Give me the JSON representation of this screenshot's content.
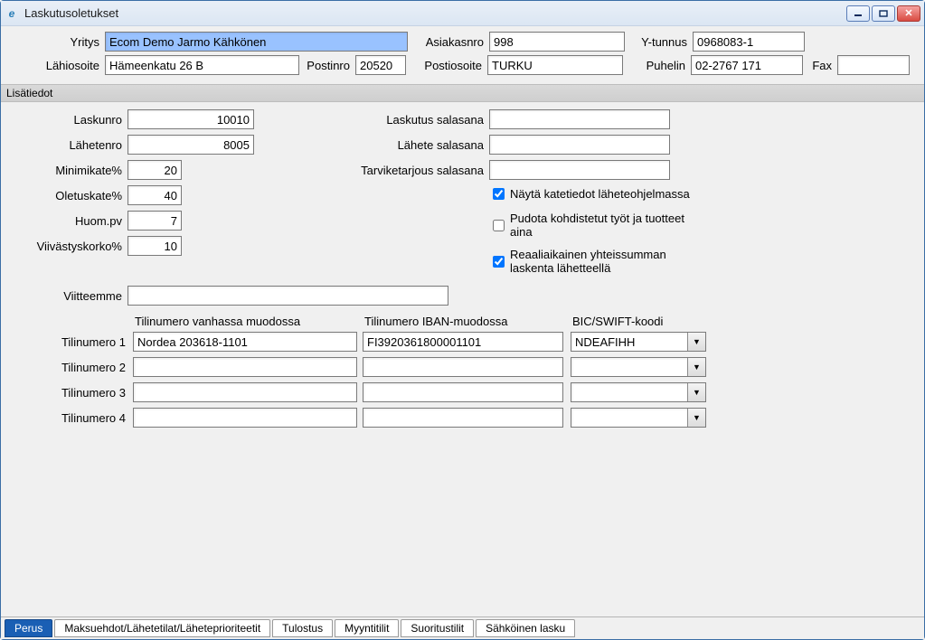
{
  "window": {
    "title": "Laskutusoletukset"
  },
  "top": {
    "labels": {
      "yritys": "Yritys",
      "asiakasnro": "Asiakasnro",
      "ytunnus": "Y-tunnus",
      "lahiosoite": "Lähiosoite",
      "postinro": "Postinro",
      "postiosoite": "Postiosoite",
      "puhelin": "Puhelin",
      "fax": "Fax"
    },
    "values": {
      "yritys": "Ecom Demo Jarmo Kähkönen",
      "asiakasnro": "998",
      "ytunnus": "0968083-1",
      "lahiosoite": "Hämeenkatu 26 B",
      "postinro": "20520",
      "postiosoite": "TURKU",
      "puhelin": "02-2767 171",
      "fax": ""
    }
  },
  "section": {
    "lisatiedot": "Lisätiedot"
  },
  "left": {
    "labels": {
      "laskunro": "Laskunro",
      "lahetenro": "Lähetenro",
      "minimikate": "Minimikate%",
      "oletuskate": "Oletuskate%",
      "huompv": "Huom.pv",
      "viivastyskorko": "Viivästyskorko%",
      "viitteemme": "Viitteemme"
    },
    "values": {
      "laskunro": "10010",
      "lahetenro": "8005",
      "minimikate": "20",
      "oletuskate": "40",
      "huompv": "7",
      "viivastyskorko": "10",
      "viitteemme": ""
    }
  },
  "mid": {
    "labels": {
      "laskutus_salasana": "Laskutus salasana",
      "lahete_salasana": "Lähete salasana",
      "tarviketarjous_salasana": "Tarviketarjous salasana"
    },
    "values": {
      "laskutus_salasana": "",
      "lahete_salasana": "",
      "tarviketarjous_salasana": ""
    }
  },
  "checks": {
    "nayta_katetiedot": "Näytä katetiedot läheteohjelmassa",
    "pudota_kohdistetut": "Pudota kohdistetut työt ja tuotteet aina",
    "reaaliaikainen": "Reaaliaikainen yhteissumman laskenta lähetteellä"
  },
  "bank": {
    "headers": {
      "vanha": "Tilinumero vanhassa muodossa",
      "iban": "Tilinumero IBAN-muodossa",
      "bic": "BIC/SWIFT-koodi"
    },
    "row_labels": {
      "r1": "Tilinumero 1",
      "r2": "Tilinumero 2",
      "r3": "Tilinumero 3",
      "r4": "Tilinumero 4"
    },
    "rows": {
      "r1": {
        "vanha": "Nordea 203618-1101",
        "iban": "FI3920361800001101",
        "bic": "NDEAFIHH"
      },
      "r2": {
        "vanha": "",
        "iban": "",
        "bic": ""
      },
      "r3": {
        "vanha": "",
        "iban": "",
        "bic": ""
      },
      "r4": {
        "vanha": "",
        "iban": "",
        "bic": ""
      }
    }
  },
  "tabs": {
    "perus": "Perus",
    "maksuehdot": "Maksuehdot/Lähetetilat/Läheteprioriteetit",
    "tulostus": "Tulostus",
    "myyntitilit": "Myyntitilit",
    "suoritustilit": "Suoritustilit",
    "sahkoinen": "Sähköinen lasku"
  }
}
